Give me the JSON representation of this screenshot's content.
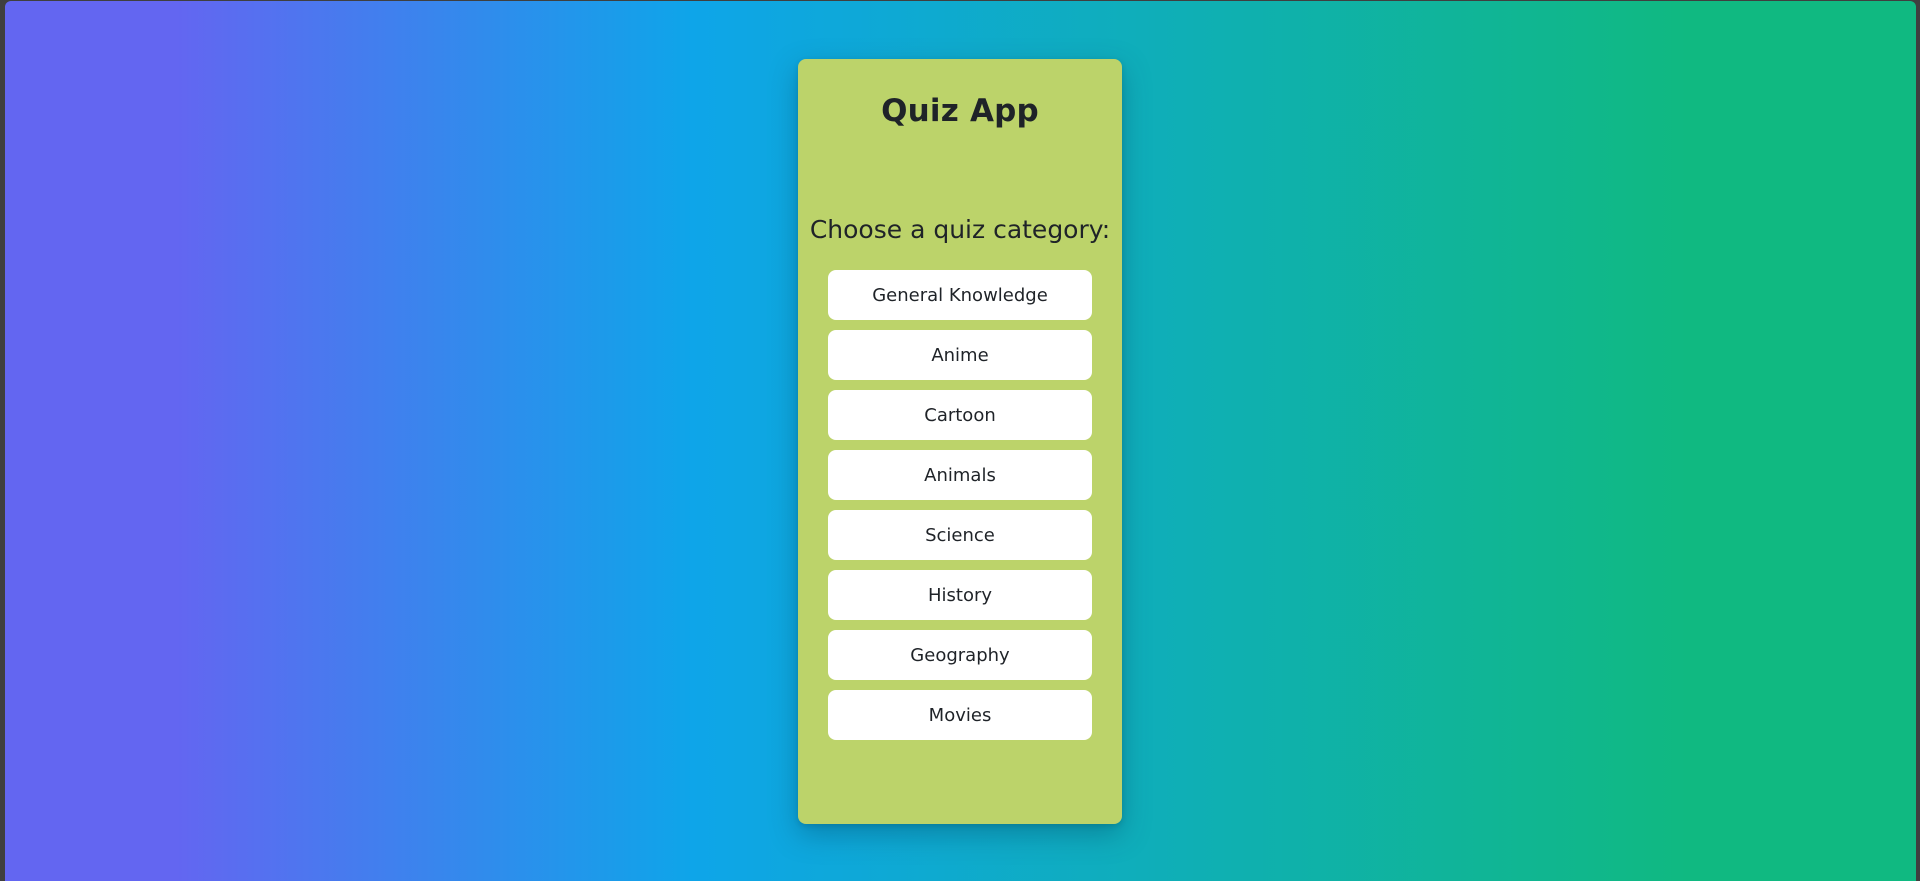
{
  "app": {
    "title": "Quiz App",
    "prompt": "Choose a quiz category:"
  },
  "categories": [
    {
      "label": "General Knowledge"
    },
    {
      "label": "Anime"
    },
    {
      "label": "Cartoon"
    },
    {
      "label": "Animals"
    },
    {
      "label": "Science"
    },
    {
      "label": "History"
    },
    {
      "label": "Geography"
    },
    {
      "label": "Movies"
    }
  ],
  "colors": {
    "gradient_start": "#6366f1",
    "gradient_mid": "#0ea5e9",
    "gradient_end": "#10b981",
    "card_background": "#bcd36a",
    "button_background": "#ffffff",
    "text": "#1f2328"
  }
}
